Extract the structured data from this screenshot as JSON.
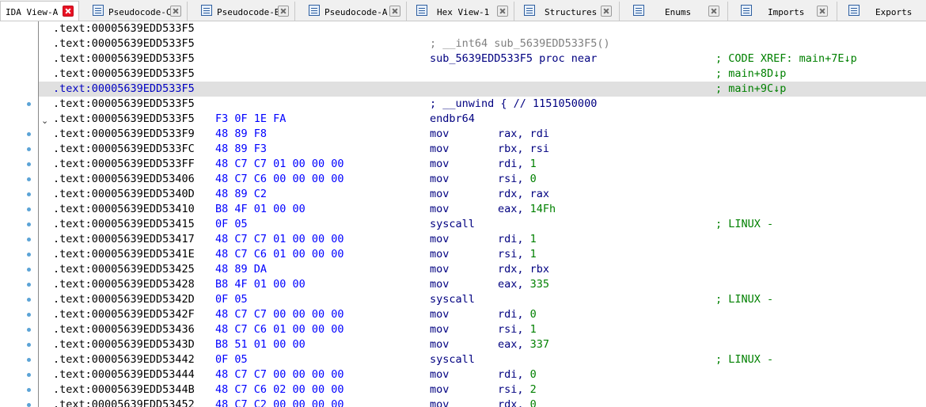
{
  "tabs": [
    {
      "label": "IDA View-A",
      "active": true,
      "icon": "none"
    },
    {
      "label": "Pseudocode-C",
      "icon": "pseudocode-icon"
    },
    {
      "label": "Pseudocode-B",
      "icon": "pseudocode-icon"
    },
    {
      "label": "Pseudocode-A",
      "icon": "pseudocode-icon"
    },
    {
      "label": "Hex View-1",
      "icon": "hex-view-icon"
    },
    {
      "label": "Structures",
      "icon": "structures-icon"
    },
    {
      "label": "Enums",
      "icon": "enums-icon"
    },
    {
      "label": "Imports",
      "icon": "imports-icon"
    },
    {
      "label": "Exports",
      "icon": "exports-icon"
    }
  ],
  "colors": {
    "address": "#000000",
    "bytes": "#0000ff",
    "mnemonic": "#000080",
    "number": "#008000",
    "comment": "#008000",
    "highlight_row": "#e0e0e0",
    "close_active": "#e81123",
    "breakpoint_dot": "#5ba3d6"
  },
  "listing": [
    {
      "addr": ".text:00005639EDD533F5",
      "bytes": "",
      "mnem": "",
      "ops": "",
      "comment": ""
    },
    {
      "addr": ".text:00005639EDD533F5",
      "bytes": "",
      "mnem": "; __int64 sub_5639EDD533F5()",
      "ops": "",
      "comment": "",
      "mnem_gray": true
    },
    {
      "addr": ".text:00005639EDD533F5",
      "bytes": "",
      "mnem": "sub_5639EDD533F5 proc near",
      "ops": "",
      "comment": "; CODE XREF: main+7E↓p"
    },
    {
      "addr": ".text:00005639EDD533F5",
      "bytes": "",
      "mnem": "",
      "ops": "",
      "comment": "; main+8D↓p"
    },
    {
      "addr": ".text:00005639EDD533F5",
      "bytes": "",
      "mnem": "",
      "ops": "",
      "comment": "; main+9C↓p",
      "highlight": true
    },
    {
      "addr": ".text:00005639EDD533F5",
      "bytes": "",
      "mnem": "; __unwind { // 1151050000",
      "ops": "",
      "comment": ""
    },
    {
      "addr": ".text:00005639EDD533F5",
      "bytes": "F3 0F 1E FA",
      "mnem": "endbr64",
      "ops": "",
      "comment": ""
    },
    {
      "addr": ".text:00005639EDD533F9",
      "bytes": "48 89 F8",
      "mnem": "mov",
      "ops": "rax, rdi",
      "comment": ""
    },
    {
      "addr": ".text:00005639EDD533FC",
      "bytes": "48 89 F3",
      "mnem": "mov",
      "ops": "rbx, rsi",
      "comment": ""
    },
    {
      "addr": ".text:00005639EDD533FF",
      "bytes": "48 C7 C7 01 00 00 00",
      "mnem": "mov",
      "ops": "rdi, 1",
      "comment": ""
    },
    {
      "addr": ".text:00005639EDD53406",
      "bytes": "48 C7 C6 00 00 00 00",
      "mnem": "mov",
      "ops": "rsi, 0",
      "comment": ""
    },
    {
      "addr": ".text:00005639EDD5340D",
      "bytes": "48 89 C2",
      "mnem": "mov",
      "ops": "rdx, rax",
      "comment": ""
    },
    {
      "addr": ".text:00005639EDD53410",
      "bytes": "B8 4F 01 00 00",
      "mnem": "mov",
      "ops": "eax, 14Fh",
      "comment": ""
    },
    {
      "addr": ".text:00005639EDD53415",
      "bytes": "0F 05",
      "mnem": "syscall",
      "ops": "",
      "comment": "; LINUX -"
    },
    {
      "addr": ".text:00005639EDD53417",
      "bytes": "48 C7 C7 01 00 00 00",
      "mnem": "mov",
      "ops": "rdi, 1",
      "comment": ""
    },
    {
      "addr": ".text:00005639EDD5341E",
      "bytes": "48 C7 C6 01 00 00 00",
      "mnem": "mov",
      "ops": "rsi, 1",
      "comment": ""
    },
    {
      "addr": ".text:00005639EDD53425",
      "bytes": "48 89 DA",
      "mnem": "mov",
      "ops": "rdx, rbx",
      "comment": ""
    },
    {
      "addr": ".text:00005639EDD53428",
      "bytes": "B8 4F 01 00 00",
      "mnem": "mov",
      "ops": "eax, 335",
      "comment": ""
    },
    {
      "addr": ".text:00005639EDD5342D",
      "bytes": "0F 05",
      "mnem": "syscall",
      "ops": "",
      "comment": "; LINUX -"
    },
    {
      "addr": ".text:00005639EDD5342F",
      "bytes": "48 C7 C7 00 00 00 00",
      "mnem": "mov",
      "ops": "rdi, 0",
      "comment": ""
    },
    {
      "addr": ".text:00005639EDD53436",
      "bytes": "48 C7 C6 01 00 00 00",
      "mnem": "mov",
      "ops": "rsi, 1",
      "comment": ""
    },
    {
      "addr": ".text:00005639EDD5343D",
      "bytes": "B8 51 01 00 00",
      "mnem": "mov",
      "ops": "eax, 337",
      "comment": ""
    },
    {
      "addr": ".text:00005639EDD53442",
      "bytes": "0F 05",
      "mnem": "syscall",
      "ops": "",
      "comment": "; LINUX -"
    },
    {
      "addr": ".text:00005639EDD53444",
      "bytes": "48 C7 C7 00 00 00 00",
      "mnem": "mov",
      "ops": "rdi, 0",
      "comment": ""
    },
    {
      "addr": ".text:00005639EDD5344B",
      "bytes": "48 C7 C6 02 00 00 00",
      "mnem": "mov",
      "ops": "rsi, 2",
      "comment": ""
    },
    {
      "addr": ".text:00005639EDD53452",
      "bytes": "48 C7 C2 00 00 00 00",
      "mnem": "mov",
      "ops": "rdx, 0",
      "comment": ""
    }
  ]
}
